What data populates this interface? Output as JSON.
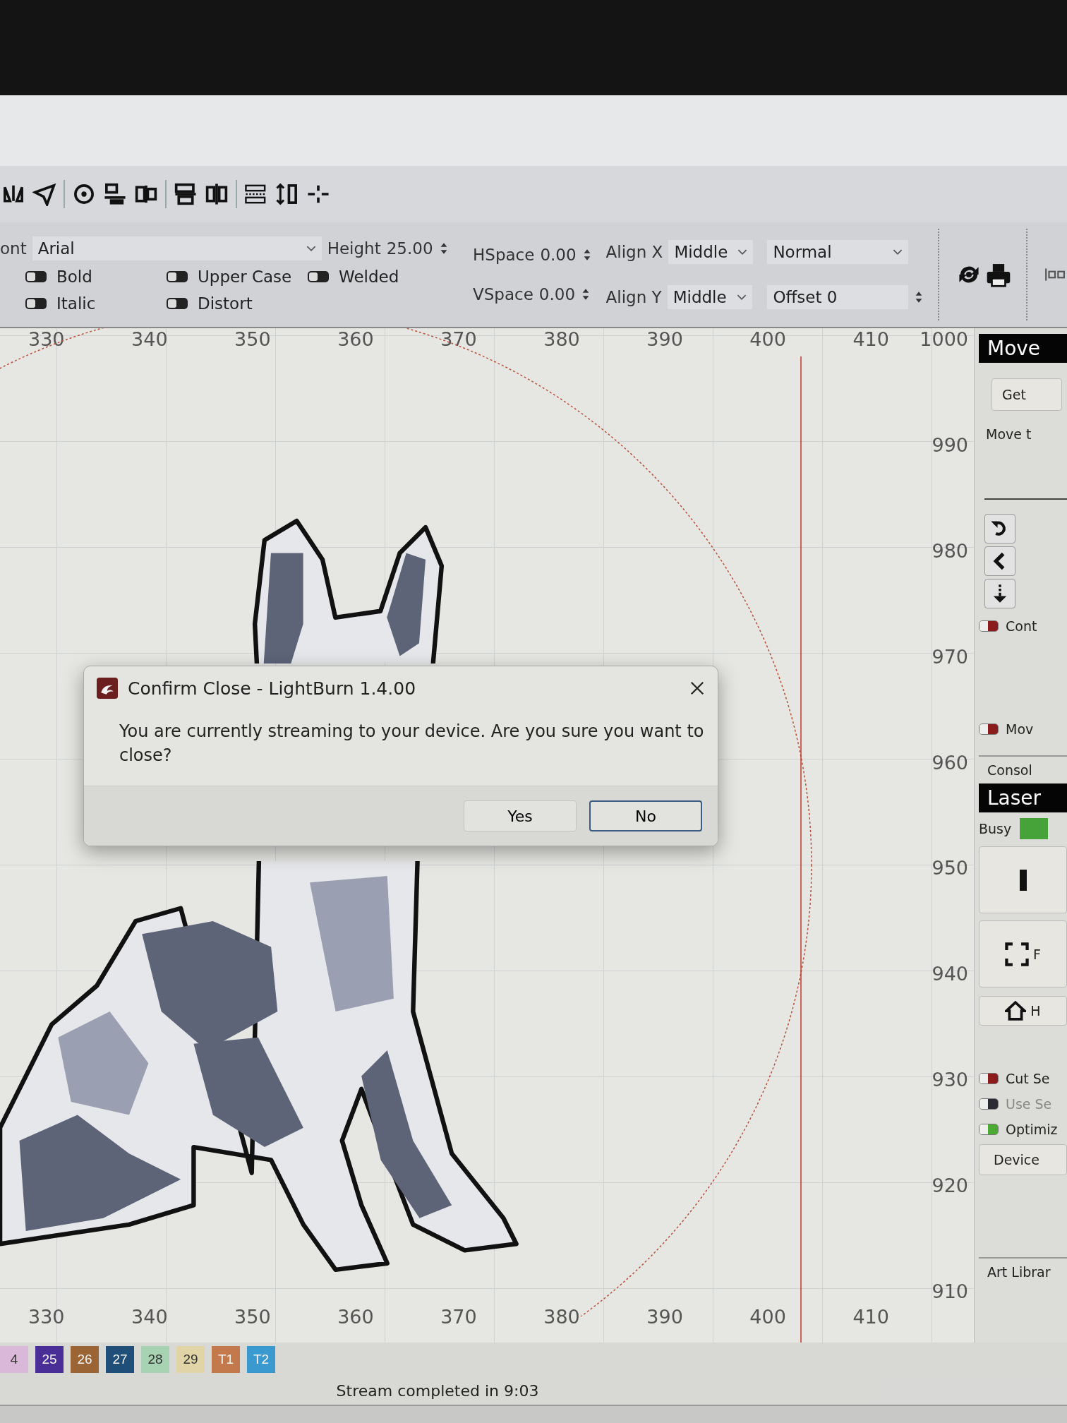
{
  "text_options": {
    "font_label": "ont",
    "font_value": "Arial",
    "height_label": "Height",
    "height_value": "25.00",
    "toggles": [
      {
        "label": "Bold",
        "on": false
      },
      {
        "label": "Upper Case",
        "on": false
      },
      {
        "label": "Welded",
        "on": false
      },
      {
        "label": "Italic",
        "on": false
      },
      {
        "label": "Distort",
        "on": false
      }
    ],
    "hspace_label": "HSpace",
    "hspace_value": "0.00",
    "vspace_label": "VSpace",
    "vspace_value": "0.00",
    "align_x_label": "Align X",
    "align_x_value": "Middle",
    "align_y_label": "Align Y",
    "align_y_value": "Middle",
    "style_value": "Normal",
    "offset_value": "Offset 0"
  },
  "canvas": {
    "top_ruler": [
      "330",
      "340",
      "350",
      "360",
      "370",
      "380",
      "390",
      "400",
      "410"
    ],
    "side_ruler": [
      "1000",
      "990",
      "980",
      "970",
      "960",
      "950",
      "940",
      "930",
      "920",
      "910"
    ],
    "bottom_ruler": [
      "330",
      "340",
      "350",
      "360",
      "370",
      "380",
      "390",
      "400",
      "410"
    ]
  },
  "right_panel": {
    "move_title": "Move",
    "get_button": "Get",
    "move_text": "Move t",
    "move_toggles": [
      {
        "label": "Cont",
        "color": "#8a1c1c"
      },
      {
        "label": "Mov",
        "color": "#8a1c1c"
      }
    ],
    "console_tab": "Consol",
    "laser_title": "Laser",
    "busy_label": "Busy",
    "frame_button": "F",
    "home_button": "H",
    "laser_toggles": [
      {
        "label": "Cut Se",
        "color": "#8a1c1c",
        "disabled": false
      },
      {
        "label": "Use Se",
        "color": "#2a2a33",
        "disabled": true
      },
      {
        "label": "Optimiz",
        "color": "#4caa34",
        "disabled": false
      }
    ],
    "device_button": "Device",
    "art_library_tab": "Art Librar"
  },
  "palette": [
    {
      "label": "4",
      "color": "#d9b8d9"
    },
    {
      "label": "25",
      "color": "#4a2e98"
    },
    {
      "label": "26",
      "color": "#9a6434"
    },
    {
      "label": "27",
      "color": "#1f4f78"
    },
    {
      "label": "28",
      "color": "#a8d3b3"
    },
    {
      "label": "29",
      "color": "#e1d5a8"
    },
    {
      "label": "T1",
      "color": "#c4794c"
    },
    {
      "label": "T2",
      "color": "#3a9ad0"
    }
  ],
  "status_bar": "Stream completed in 9:03",
  "dialog": {
    "title": "Confirm Close - LightBurn 1.4.00",
    "message": "You are currently streaming to your device. Are you sure you want to close?",
    "buttons": [
      {
        "label": "Yes",
        "default": false
      },
      {
        "label": "No",
        "default": true
      }
    ]
  }
}
